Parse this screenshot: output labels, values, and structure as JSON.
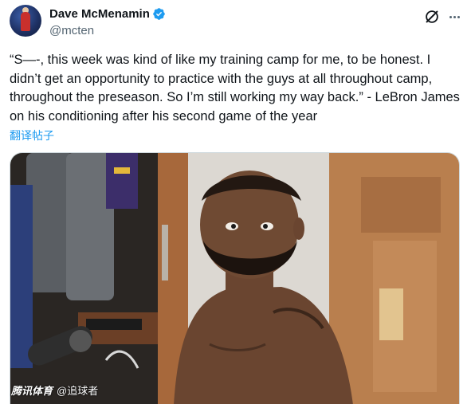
{
  "author": {
    "display_name": "Dave McMenamin",
    "handle": "@mcten",
    "verified": true,
    "avatar_icon": "avatar-icon"
  },
  "actions": {
    "grok_icon": "grok-icon",
    "more_icon": "more-horizontal-icon"
  },
  "tweet": {
    "text": "“S—-, this week was kind of like my training camp for me, to be honest. I didn’t get an opportunity to practice with the guys at all throughout camp, throughout the preseason. So I’m still working my way back.” - LeBron James on his conditioning after his second game of the year",
    "translate_label": "翻译帖子"
  },
  "media": {
    "watermark_brand": "腾讯体育",
    "watermark_account": "@追球者"
  },
  "colors": {
    "link": "#1d9bf0",
    "verified": "#1d9bf0",
    "secondary_text": "#536471"
  }
}
